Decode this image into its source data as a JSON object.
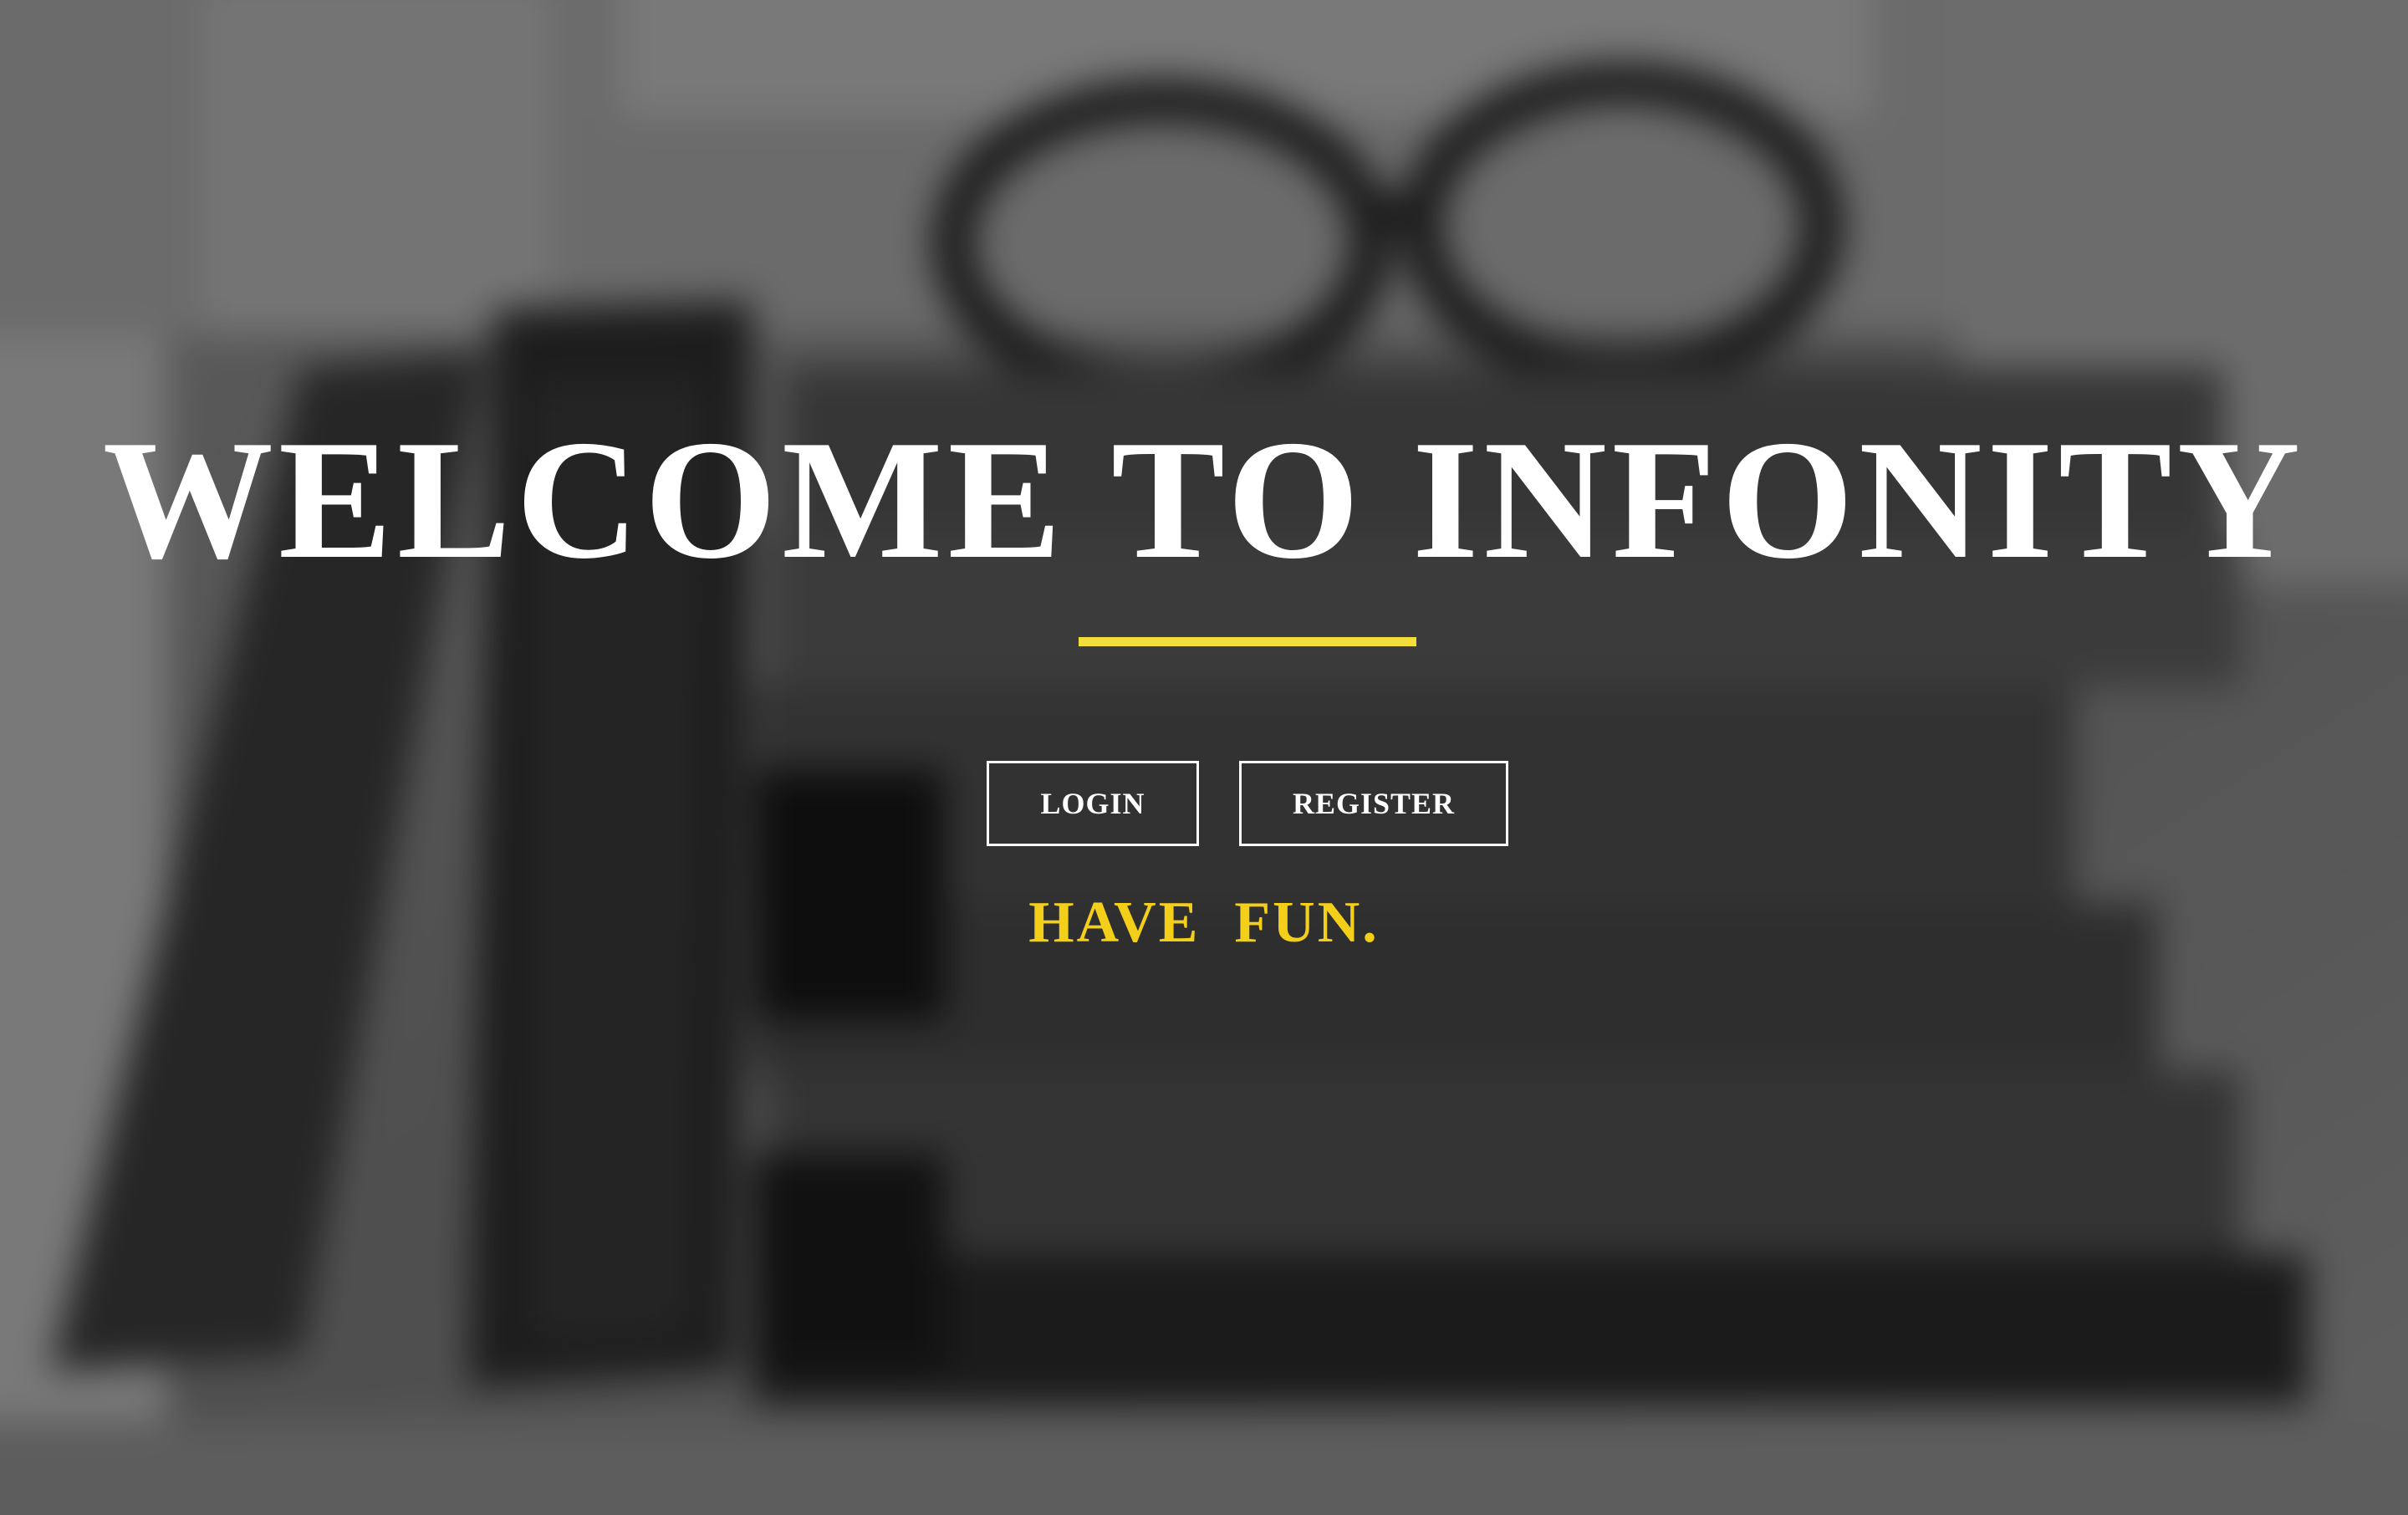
{
  "hero": {
    "title": "WELCOME TO INFONITY",
    "tagline": "HAVE  FUN."
  },
  "actions": {
    "login_label": "LOGIN",
    "register_label": "REGISTER"
  },
  "colors": {
    "accent": "#f3dd3c",
    "tagline": "#f3cf1a",
    "text": "#ffffff"
  }
}
